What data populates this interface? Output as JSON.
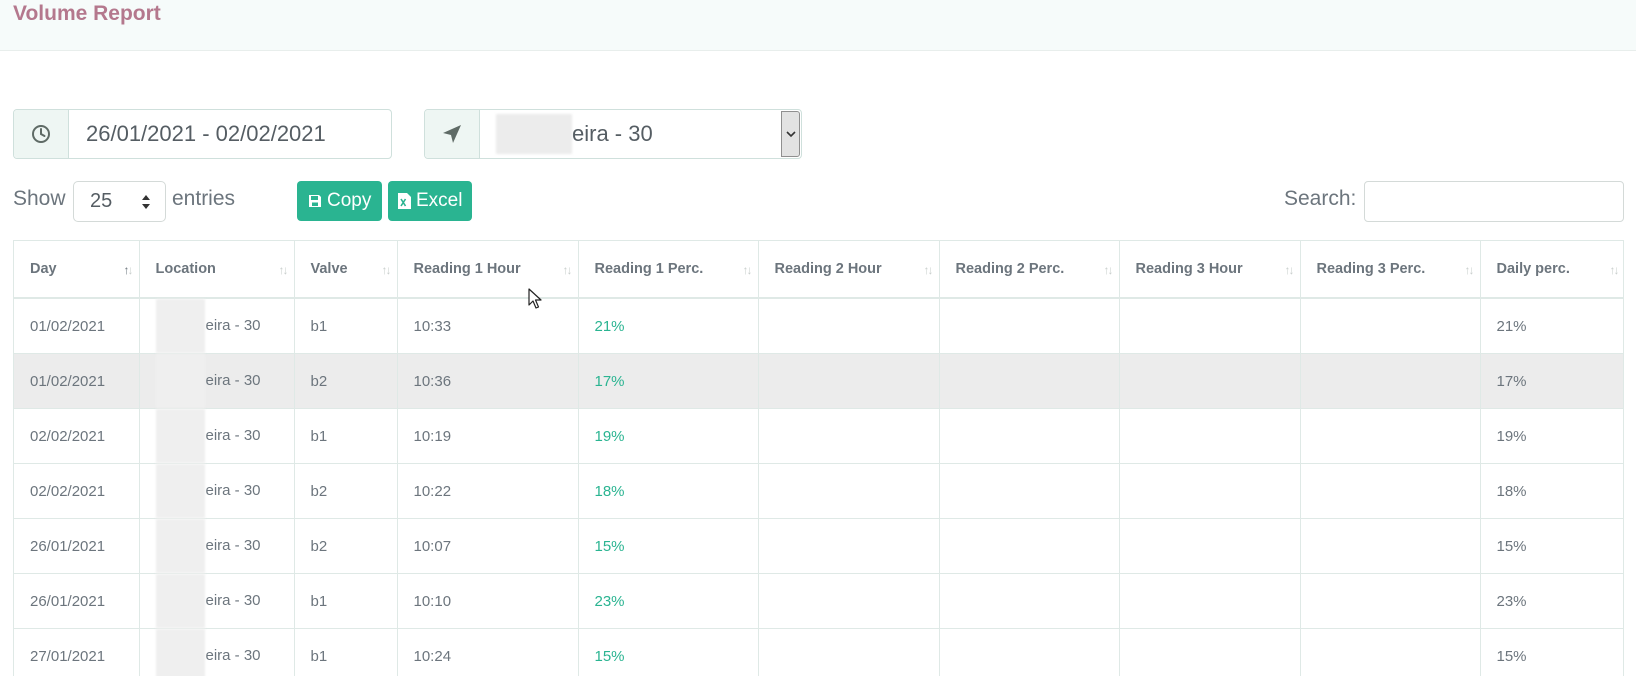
{
  "page": {
    "title": "Volume Report"
  },
  "filters": {
    "date_range": "26/01/2021 - 02/02/2021",
    "date_icon": "clock-icon",
    "location_value": "eira - 30",
    "location_icon": "location-arrow-icon",
    "select_arrow_icon": "chevron-down-icon"
  },
  "controls": {
    "show_label": "Show",
    "entries_value": "25",
    "entries_label": "entries",
    "copy_label": "Copy",
    "copy_icon": "floppy-disk-icon",
    "excel_label": "Excel",
    "excel_icon": "excel-file-icon",
    "search_label": "Search:",
    "search_value": ""
  },
  "table": {
    "columns": [
      "Day",
      "Location",
      "Valve",
      "Reading 1 Hour",
      "Reading 1 Perc.",
      "Reading 2 Hour",
      "Reading 2 Perc.",
      "Reading 3 Hour",
      "Reading 3 Perc.",
      "Daily perc."
    ],
    "sorted_column": "Day",
    "rows": [
      {
        "day": "01/02/2021",
        "location": "eira - 30",
        "valve": "b1",
        "r1_hour": "10:33",
        "r1_perc": "21%",
        "r2_hour": "",
        "r2_perc": "",
        "r3_hour": "",
        "r3_perc": "",
        "daily": "21%"
      },
      {
        "day": "01/02/2021",
        "location": "eira - 30",
        "valve": "b2",
        "r1_hour": "10:36",
        "r1_perc": "17%",
        "r2_hour": "",
        "r2_perc": "",
        "r3_hour": "",
        "r3_perc": "",
        "daily": "17%"
      },
      {
        "day": "02/02/2021",
        "location": "eira - 30",
        "valve": "b1",
        "r1_hour": "10:19",
        "r1_perc": "19%",
        "r2_hour": "",
        "r2_perc": "",
        "r3_hour": "",
        "r3_perc": "",
        "daily": "19%"
      },
      {
        "day": "02/02/2021",
        "location": "eira - 30",
        "valve": "b2",
        "r1_hour": "10:22",
        "r1_perc": "18%",
        "r2_hour": "",
        "r2_perc": "",
        "r3_hour": "",
        "r3_perc": "",
        "daily": "18%"
      },
      {
        "day": "26/01/2021",
        "location": "eira - 30",
        "valve": "b2",
        "r1_hour": "10:07",
        "r1_perc": "15%",
        "r2_hour": "",
        "r2_perc": "",
        "r3_hour": "",
        "r3_perc": "",
        "daily": "15%"
      },
      {
        "day": "26/01/2021",
        "location": "eira - 30",
        "valve": "b1",
        "r1_hour": "10:10",
        "r1_perc": "23%",
        "r2_hour": "",
        "r2_perc": "",
        "r3_hour": "",
        "r3_perc": "",
        "daily": "23%"
      },
      {
        "day": "27/01/2021",
        "location": "eira - 30",
        "valve": "b1",
        "r1_hour": "10:24",
        "r1_perc": "15%",
        "r2_hour": "",
        "r2_perc": "",
        "r3_hour": "",
        "r3_perc": "",
        "daily": "15%"
      }
    ]
  },
  "colors": {
    "title": "#b4788d",
    "button": "#2ab491",
    "percent_text": "#2ab491",
    "highlight_row": "#ececec"
  }
}
